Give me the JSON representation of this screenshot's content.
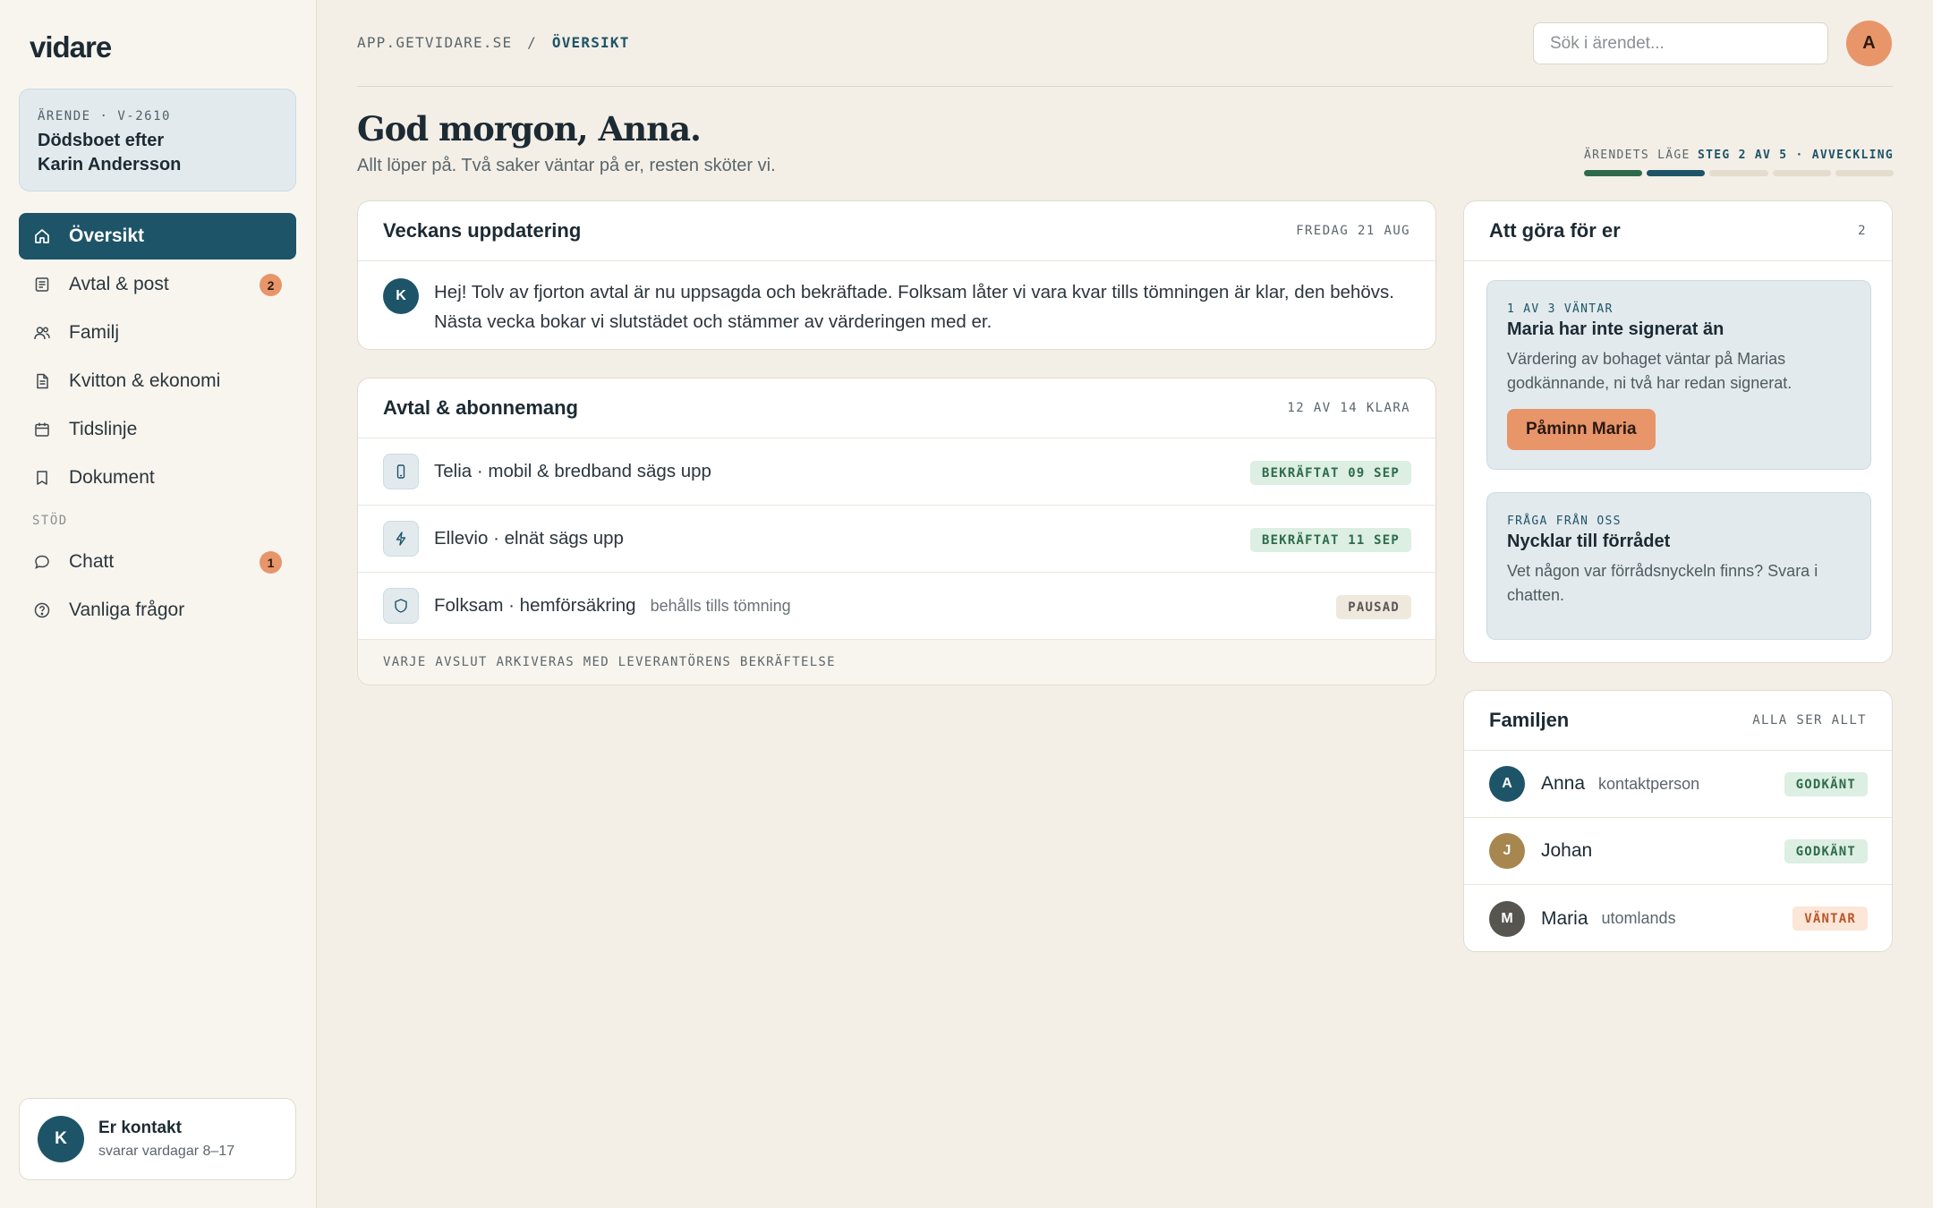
{
  "brand": "vidare",
  "case": {
    "kicker": "ÄRENDE · V-2610",
    "title": "Dödsboet efter Karin Andersson"
  },
  "nav": {
    "items": [
      {
        "label": "Översikt",
        "icon": "home-icon",
        "active": true
      },
      {
        "label": "Avtal & post",
        "icon": "document-list-icon",
        "badge": "2"
      },
      {
        "label": "Familj",
        "icon": "people-icon"
      },
      {
        "label": "Kvitton & ekonomi",
        "icon": "receipt-icon"
      },
      {
        "label": "Tidslinje",
        "icon": "calendar-icon"
      },
      {
        "label": "Dokument",
        "icon": "book-icon"
      }
    ],
    "support_label": "STÖD",
    "support_items": [
      {
        "label": "Chatt",
        "icon": "chat-icon",
        "badge": "1"
      },
      {
        "label": "Vanliga frågor",
        "icon": "help-icon"
      }
    ]
  },
  "contact": {
    "initial": "K",
    "title": "Er kontakt",
    "subtitle": "svarar vardagar 8–17"
  },
  "breadcrumb": {
    "root": "APP.GETVIDARE.SE",
    "separator": "/",
    "current": "ÖVERSIKT"
  },
  "search": {
    "placeholder": "Sök i ärendet..."
  },
  "user": {
    "initial": "A"
  },
  "greeting": {
    "title": "God morgon, Anna.",
    "subtitle": "Allt löper på. Två saker väntar på er, resten sköter vi."
  },
  "progress": {
    "label": "ÄRENDETS LÄGE",
    "step": "STEG 2 AV 5 · AVVECKLING",
    "current_step": 2,
    "total_steps": 5
  },
  "update": {
    "title": "Veckans uppdatering",
    "date": "FREDAG 21 AUG",
    "author_initial": "K",
    "text": "Hej! Tolv av fjorton avtal är nu uppsagda och bekräftade. Folksam låter vi vara kvar tills tömningen är klar, den behövs. Nästa vecka bokar vi slutstädet och stämmer av värderingen med er."
  },
  "contracts": {
    "title": "Avtal & abonnemang",
    "meta": "12 AV 14 KLARA",
    "rows": [
      {
        "icon": "phone-icon",
        "label": "Telia · mobil & bredband sägs upp",
        "note": "",
        "status": "BEKRÄFTAT 09 SEP"
      },
      {
        "icon": "lightning-icon",
        "label": "Ellevio · elnät sägs upp",
        "note": "",
        "status": "BEKRÄFTAT 11 SEP"
      },
      {
        "icon": "shield-icon",
        "label": "Folksam · hemförsäkring",
        "note": "behålls tills tömning",
        "status": "PAUSAD"
      }
    ],
    "footer": "VARJE AVSLUT ARKIVERAS MED LEVERANTÖRENS BEKRÄFTELSE"
  },
  "todo": {
    "title": "Att göra för er",
    "count": "2",
    "items": [
      {
        "kicker": "1 AV 3 VÄNTAR",
        "title": "Maria har inte signerat än",
        "text": "Värdering av bohaget väntar på Marias godkännande, ni två har redan signerat.",
        "button": "Påminn Maria"
      },
      {
        "kicker": "FRÅGA FRÅN OSS",
        "title": "Nycklar till förrådet",
        "text": "Vet någon var förrådsnyckeln finns? Svara i chatten."
      }
    ]
  },
  "family": {
    "title": "Familjen",
    "meta": "ALLA SER ALLT",
    "members": [
      {
        "initial": "A",
        "name": "Anna",
        "role": "kontaktperson",
        "status": "GODKÄNT",
        "color": "#1e5468"
      },
      {
        "initial": "J",
        "name": "Johan",
        "role": "",
        "status": "GODKÄNT",
        "color": "#a8864f"
      },
      {
        "initial": "M",
        "name": "Maria",
        "role": "utomlands",
        "status": "VÄNTAR",
        "color": "#575550"
      }
    ]
  },
  "colors": {
    "accent": "#1e5468",
    "orange": "#e8956a",
    "green": "#2e6b4c",
    "background": "#f3efe7"
  }
}
